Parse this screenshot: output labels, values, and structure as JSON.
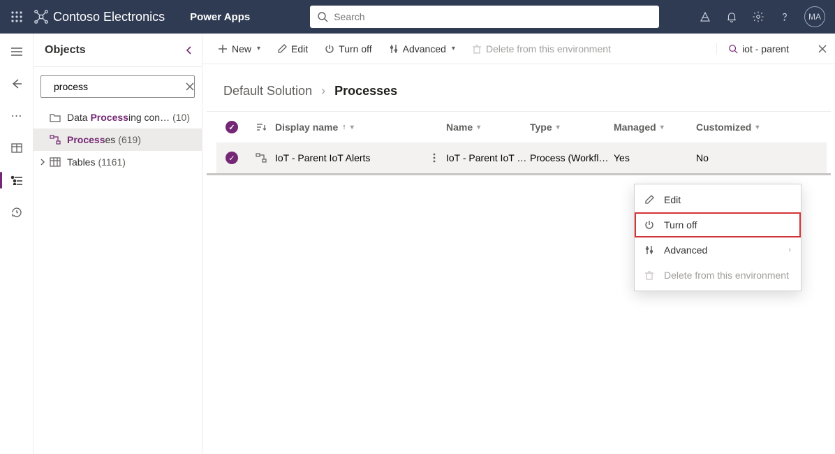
{
  "header": {
    "org_name": "Contoso Electronics",
    "app_name": "Power Apps",
    "search_placeholder": "Search",
    "avatar_initials": "MA"
  },
  "objects": {
    "title": "Objects",
    "search_value": "process",
    "items": [
      {
        "id": "data-processing",
        "pre": "Data ",
        "match": "Process",
        "post": "ing con…",
        "count": "(10)",
        "icon": "folder"
      },
      {
        "id": "processes",
        "pre": "",
        "match": "Process",
        "post": "es",
        "count": "(619)",
        "icon": "process",
        "selected": true
      },
      {
        "id": "tables",
        "pre": "Tables",
        "match": "",
        "post": "",
        "count": "(1161)",
        "icon": "table",
        "chevron": true
      }
    ]
  },
  "commandbar": {
    "new_label": "New",
    "edit_label": "Edit",
    "turn_off_label": "Turn off",
    "advanced_label": "Advanced",
    "delete_label": "Delete from this environment",
    "filter_text": "iot - parent"
  },
  "breadcrumb": {
    "root": "Default Solution",
    "current": "Processes"
  },
  "table": {
    "columns": {
      "display_name": "Display name",
      "name": "Name",
      "type": "Type",
      "managed": "Managed",
      "customized": "Customized"
    },
    "rows": [
      {
        "display_name": "IoT - Parent IoT Alerts",
        "name": "IoT - Parent IoT …",
        "type": "Process (Workflo…",
        "managed": "Yes",
        "customized": "No"
      }
    ]
  },
  "context_menu": {
    "edit": "Edit",
    "turn_off": "Turn off",
    "advanced": "Advanced",
    "delete": "Delete from this environment"
  }
}
